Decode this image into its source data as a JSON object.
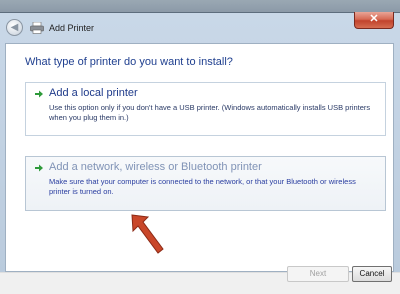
{
  "window": {
    "title": "Add Printer",
    "close_glyph": "✕",
    "back_glyph": "◀"
  },
  "page": {
    "heading": "What type of printer do you want to install?"
  },
  "options": [
    {
      "title": "Add a local printer",
      "description": "Use this option only if you don't have a USB printer. (Windows automatically installs USB printers when you plug them in.)"
    },
    {
      "title": "Add a network, wireless or Bluetooth printer",
      "description": "Make sure that your computer is connected to the network, or that your Bluetooth or wireless printer is turned on."
    }
  ],
  "buttons": {
    "next": "Next",
    "cancel": "Cancel"
  },
  "colors": {
    "heading": "#1f3f8f",
    "option_arrow": "#2e9a3a",
    "annotation_arrow": "#c9472a"
  },
  "icons": [
    "back-arrow-icon",
    "printer-icon",
    "close-icon",
    "green-arrow-icon",
    "annotation-arrow"
  ]
}
